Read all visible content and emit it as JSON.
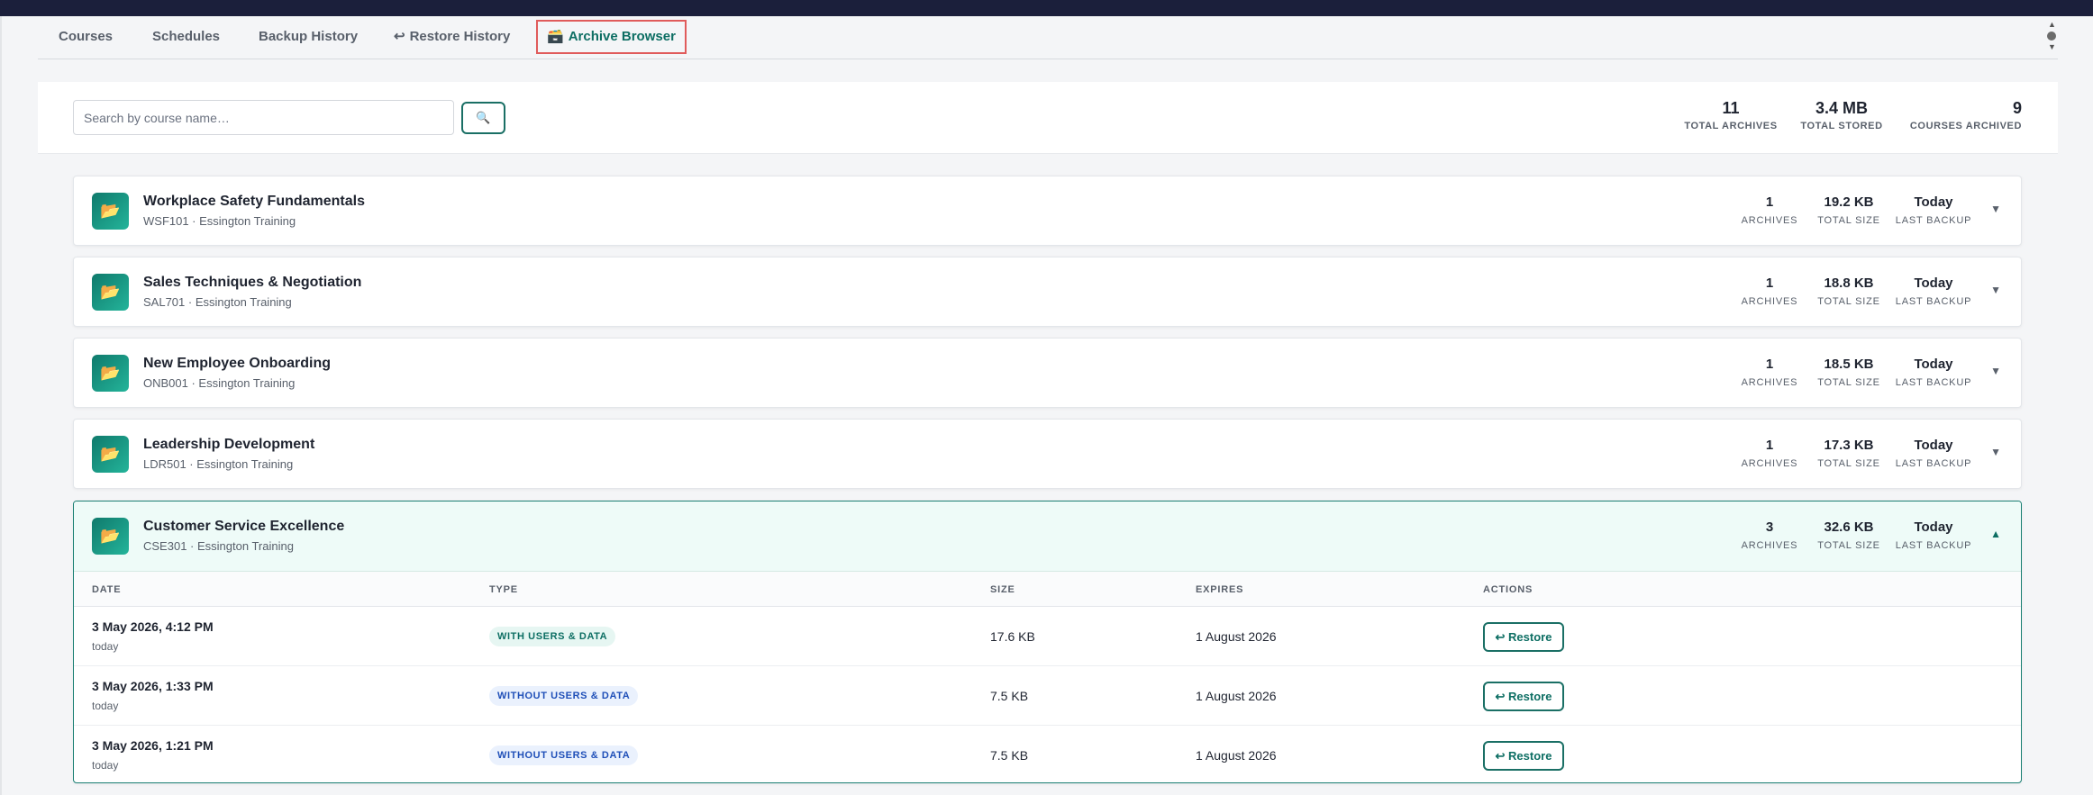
{
  "tabs": [
    {
      "icon": "",
      "label": "Courses"
    },
    {
      "icon": "",
      "label": "Schedules"
    },
    {
      "icon": "",
      "label": "Backup History"
    },
    {
      "icon": "↩",
      "label": "Restore History"
    },
    {
      "icon": "🗃️",
      "label": "Archive Browser"
    }
  ],
  "search": {
    "placeholder": "Search by course name…",
    "button_icon": "🔍"
  },
  "summary": [
    {
      "value": "11",
      "label": "TOTAL ARCHIVES"
    },
    {
      "value": "3.4 MB",
      "label": "TOTAL STORED"
    },
    {
      "value": "9",
      "label": "COURSES ARCHIVED"
    }
  ],
  "course_stat_labels": [
    "ARCHIVES",
    "TOTAL SIZE",
    "LAST BACKUP"
  ],
  "courses": [
    {
      "icon": "📂",
      "title": "Workplace Safety Fundamentals",
      "subtitle": "WSF101 · Essington Training",
      "archives": "1",
      "size": "19.2 KB",
      "last": "Today",
      "chevron": "▼"
    },
    {
      "icon": "📂",
      "title": "Sales Techniques & Negotiation",
      "subtitle": "SAL701 · Essington Training",
      "archives": "1",
      "size": "18.8 KB",
      "last": "Today",
      "chevron": "▼"
    },
    {
      "icon": "📂",
      "title": "New Employee Onboarding",
      "subtitle": "ONB001 · Essington Training",
      "archives": "1",
      "size": "18.5 KB",
      "last": "Today",
      "chevron": "▼"
    },
    {
      "icon": "📂",
      "title": "Leadership Development",
      "subtitle": "LDR501 · Essington Training",
      "archives": "1",
      "size": "17.3 KB",
      "last": "Today",
      "chevron": "▼"
    },
    {
      "icon": "📂",
      "title": "Customer Service Excellence",
      "subtitle": "CSE301 · Essington Training",
      "archives": "3",
      "size": "32.6 KB",
      "last": "Today",
      "chevron": "▲"
    }
  ],
  "archive_table": {
    "headers": [
      "DATE",
      "TYPE",
      "SIZE",
      "EXPIRES",
      "ACTIONS"
    ],
    "rows": [
      {
        "date": "3 May 2026, 4:12 PM",
        "relative": "today",
        "type": "WITH USERS & DATA",
        "size": "17.6 KB",
        "expires": "1 August 2026",
        "action": "↩ Restore"
      },
      {
        "date": "3 May 2026, 1:33 PM",
        "relative": "today",
        "type": "WITHOUT USERS & DATA",
        "size": "7.5 KB",
        "expires": "1 August 2026",
        "action": "↩ Restore"
      },
      {
        "date": "3 May 2026, 1:21 PM",
        "relative": "today",
        "type": "WITHOUT USERS & DATA",
        "size": "7.5 KB",
        "expires": "1 August 2026",
        "action": "↩ Restore"
      }
    ]
  },
  "colors": {
    "accent": "#0d6e63",
    "topbar": "#1b1f3b",
    "active_tab_outline": "#e05b5b",
    "badge_with_text": "#0d6e63",
    "badge_with_bg": "#e6f6f2",
    "badge_without_text": "#1f4fb8",
    "badge_without_bg": "#eaf1fd"
  }
}
